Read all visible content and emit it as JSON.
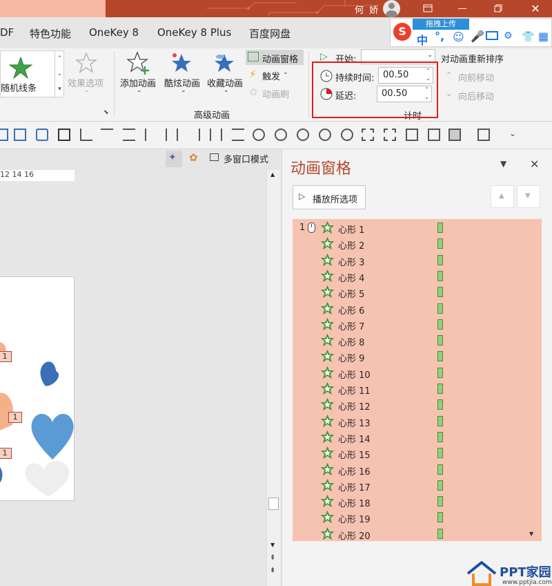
{
  "title_bar": {
    "user_name": "何 娇",
    "controls": [
      "restore-icon",
      "maximize-icon",
      "close-icon"
    ],
    "accent": "#b7472a"
  },
  "ime_bar": {
    "sogou": "S",
    "mode": "中",
    "punct": "°,",
    "upload_label": "拖拽上传"
  },
  "tabs": [
    "DF",
    "特色功能",
    "OneKey 8",
    "OneKey 8 Plus",
    "百度网盘"
  ],
  "ribbon": {
    "effect_gallery_item": "随机线条",
    "effect_options": "效果选项",
    "add_animation": "添加动画",
    "cool_animation": "酷炫动画",
    "favorite_animation": "收藏动画",
    "animation_pane": "动画窗格",
    "trigger": "触发",
    "animation_painter": "动画刷",
    "advanced_group": "高级动画",
    "start_label": "开始:",
    "start_value": "",
    "duration_label": "持续时间:",
    "duration_value": "00.50",
    "delay_label": "延迟:",
    "delay_value": "00.50",
    "reorder_label": "对动画重新排序",
    "move_earlier": "向前移动",
    "move_later": "向后移动",
    "timing_group": "计时"
  },
  "view_bar": {
    "multiwindow": "多窗口模式"
  },
  "ruler": "12 14 16",
  "slide_tags": [
    "1",
    "1",
    "1"
  ],
  "animation_pane": {
    "title": "动画窗格",
    "play_button": "播放所选项",
    "first_index": "1",
    "items": [
      "心形 1",
      "心形 2",
      "心形 3",
      "心形 4",
      "心形 5",
      "心形 6",
      "心形 7",
      "心形 8",
      "心形 9",
      "心形 10",
      "心形 11",
      "心形 12",
      "心形 13",
      "心形 14",
      "心形 15",
      "心形 16",
      "心形 17",
      "心形 18",
      "心形 19",
      "心形 20"
    ]
  },
  "watermark": {
    "brand": "PPT家园",
    "url": "www.pptjia.com"
  },
  "colors": {
    "list_bg": "#f7c3b1",
    "bar_fill": "#92d07d",
    "highlight_box": "#e4191e",
    "title_red": "#b7472a"
  }
}
